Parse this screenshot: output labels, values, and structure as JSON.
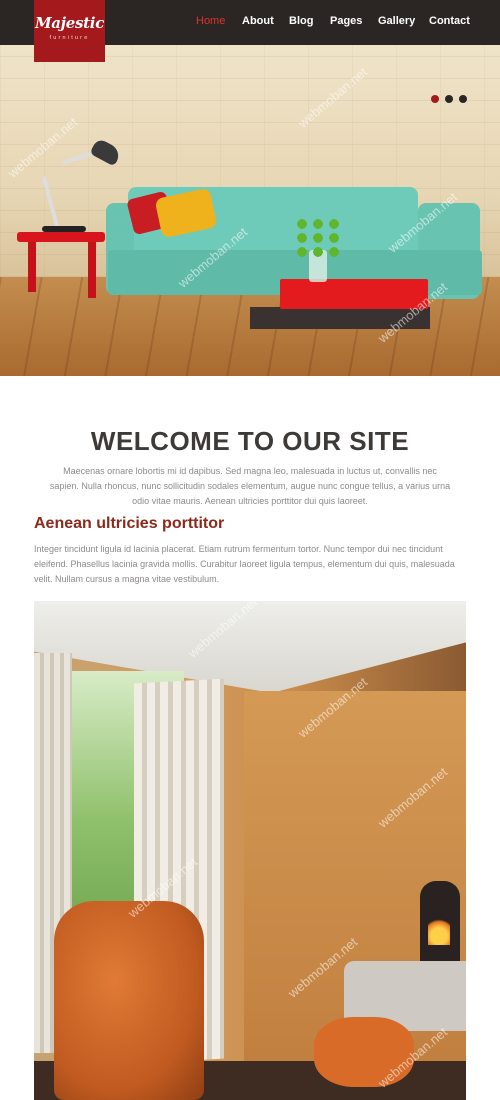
{
  "header": {
    "logo": {
      "title": "Majestic",
      "subtitle": "furniture"
    },
    "nav": [
      {
        "label": "Home",
        "active": true
      },
      {
        "label": "About",
        "active": false
      },
      {
        "label": "Blog",
        "active": false
      },
      {
        "label": "Pages",
        "active": false
      },
      {
        "label": "Gallery",
        "active": false
      },
      {
        "label": "Contact",
        "active": false
      }
    ]
  },
  "hero": {
    "image": "living-room-teal-sofa",
    "slides": 3,
    "active_slide": 1
  },
  "welcome": {
    "title": "WELCOME TO OUR SITE",
    "text": "Maecenas ornare lobortis mi id dapibus. Sed magna leo, malesuada in luctus ut, convallis nec sapien. Nulla rhoncus, nunc sollicitudin sodales elementum, augue nunc congue tellus, a varius urna odio vitae mauris. Aenean ultricies porttitor dui quis laoreet."
  },
  "section": {
    "heading": "Aenean ultricies porttitor",
    "text": "Integer tincidunt ligula id lacinia placerat. Etiam rutrum fermentum tortor. Nunc tempor dui nec tincidunt eleifend. Phasellus lacinia gravida mollis. Curabitur laoreet ligula tempus, elementum dui quis, malesuada velit. Nullam cursus a magna vitae vestibulum.",
    "image": "bedroom-orange-armchair"
  },
  "watermark": "webmoban.net",
  "colors": {
    "header_bg": "#2b2624",
    "logo_bg": "#a4191c",
    "nav_active": "#d9342b",
    "heading_accent": "#8b2a1c",
    "title_text": "#3e3a38",
    "body_text": "#8e8a88"
  }
}
